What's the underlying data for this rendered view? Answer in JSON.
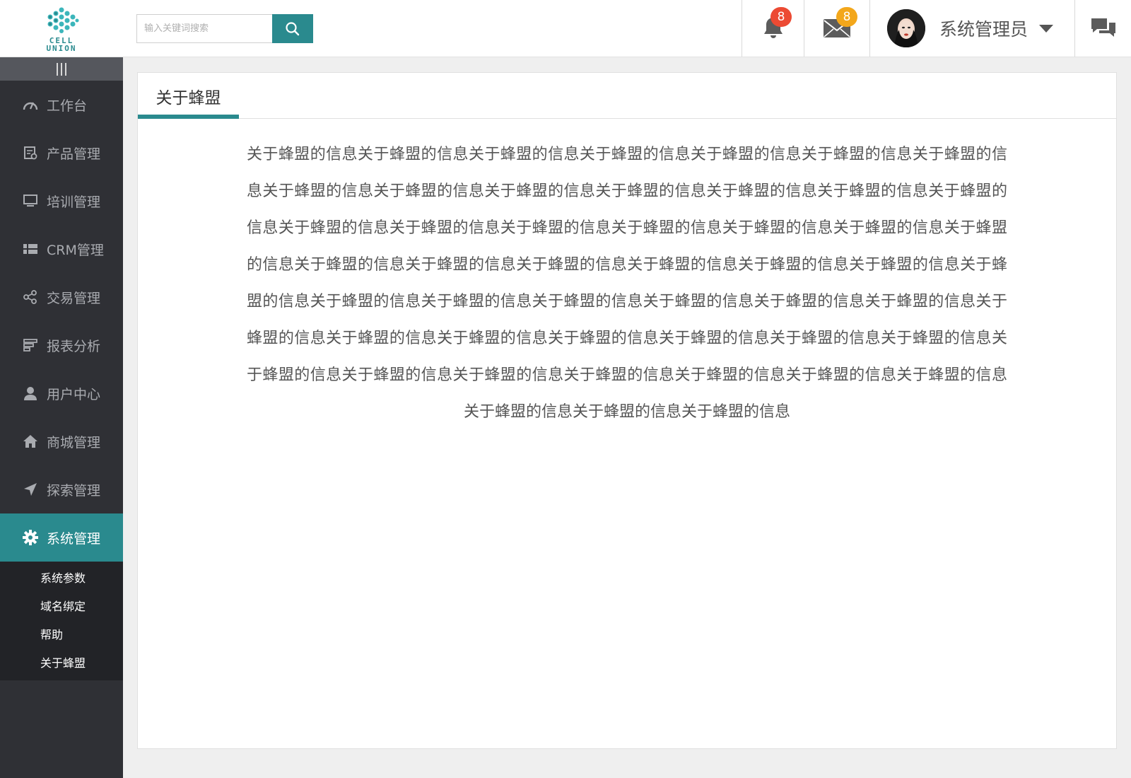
{
  "brand": {
    "logo_line1": "CELL",
    "logo_line2": "UNION",
    "accent": "#2a8a8e"
  },
  "search": {
    "placeholder": "输入关键词搜索",
    "value": "",
    "icon": "search-icon"
  },
  "header": {
    "notifications": {
      "icon": "bell-icon",
      "count": "8",
      "badge_color": "#ec4a33"
    },
    "messages": {
      "icon": "mail-icon",
      "count": "8",
      "badge_color": "#f3a71b"
    },
    "user": {
      "name": "系统管理员",
      "avatar": "avatar-photo",
      "dropdown_icon": "caret-down-icon"
    },
    "chat_icon": "chat-icon"
  },
  "sidebar": {
    "collapse_icon": "collapse-bars-icon",
    "items": [
      {
        "label": "工作台",
        "icon": "dashboard-icon"
      },
      {
        "label": "产品管理",
        "icon": "product-icon"
      },
      {
        "label": "培训管理",
        "icon": "monitor-icon"
      },
      {
        "label": "CRM管理",
        "icon": "grid-icon"
      },
      {
        "label": "交易管理",
        "icon": "share-icon"
      },
      {
        "label": "报表分析",
        "icon": "report-icon"
      },
      {
        "label": "用户中心",
        "icon": "user-icon"
      },
      {
        "label": "商城管理",
        "icon": "home-icon"
      },
      {
        "label": "探索管理",
        "icon": "send-icon"
      },
      {
        "label": "系统管理",
        "icon": "gear-icon",
        "active": true
      }
    ],
    "submenu": [
      "系统参数",
      "域名绑定",
      "帮助",
      "关于蜂盟"
    ]
  },
  "main": {
    "tab_label": "关于蜂盟",
    "about_text": "关于蜂盟的信息关于蜂盟的信息关于蜂盟的信息关于蜂盟的信息关于蜂盟的信息关于蜂盟的信息关于蜂盟的信息关于蜂盟的信息关于蜂盟的信息关于蜂盟的信息关于蜂盟的信息关于蜂盟的信息关于蜂盟的信息关于蜂盟的信息关于蜂盟的信息关于蜂盟的信息关于蜂盟的信息关于蜂盟的信息关于蜂盟的信息关于蜂盟的信息关于蜂盟的信息关于蜂盟的信息关于蜂盟的信息关于蜂盟的信息关于蜂盟的信息关于蜂盟的信息关于蜂盟的信息关于蜂盟的信息关于蜂盟的信息关于蜂盟的信息关于蜂盟的信息关于蜂盟的信息关于蜂盟的信息关于蜂盟的信息关于蜂盟的信息关于蜂盟的信息关于蜂盟的信息关于蜂盟的信息关于蜂盟的信息关于蜂盟的信息关于蜂盟的信息关于蜂盟的信息关于蜂盟的信息关于蜂盟的信息关于蜂盟的信息关于蜂盟的信息关于蜂盟的信息关于蜂盟的信息关于蜂盟的信息关于蜂盟的信息关于蜂盟的信息"
  }
}
